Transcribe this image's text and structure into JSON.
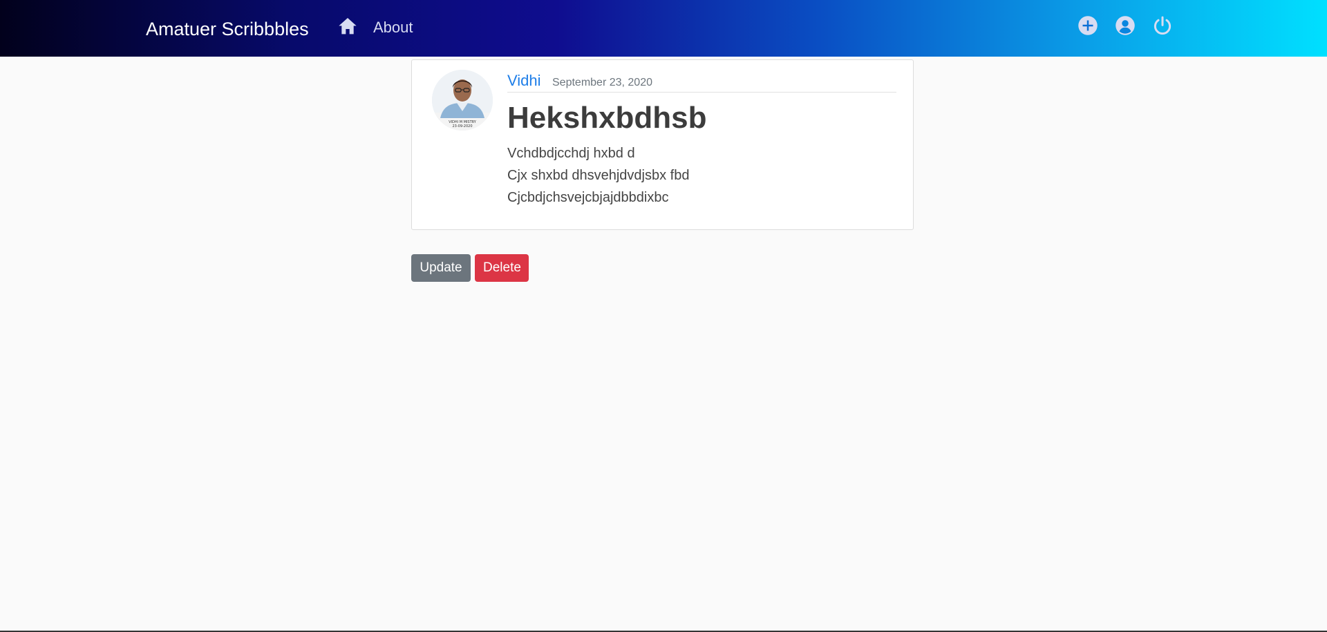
{
  "navbar": {
    "brand": "Amatuer Scribbbles",
    "home_icon": "home-icon",
    "about_label": "About",
    "right_icons": [
      "add-circle-icon",
      "account-circle-icon",
      "power-icon"
    ],
    "gradient_colors": [
      "#02011c",
      "#0f0d8f",
      "#00e0ff"
    ]
  },
  "post": {
    "author": "Vidhi",
    "date": "September 23, 2020",
    "title": "Hekshxbdhsb",
    "body_lines": [
      "Vchdbdjcchdj hxbd d",
      "Cjx shxbd dhsvehjdvdjsbx fbd",
      "Cjcbdjchsvejcbjajdbbdixbc"
    ],
    "avatar_caption_1": "VIDHI M MISTRY",
    "avatar_caption_2": "23-09-2020"
  },
  "actions": {
    "update_label": "Update",
    "delete_label": "Delete",
    "update_color": "#6c757d",
    "delete_color": "#dc3545"
  },
  "accent_color": "#1e7ee8"
}
